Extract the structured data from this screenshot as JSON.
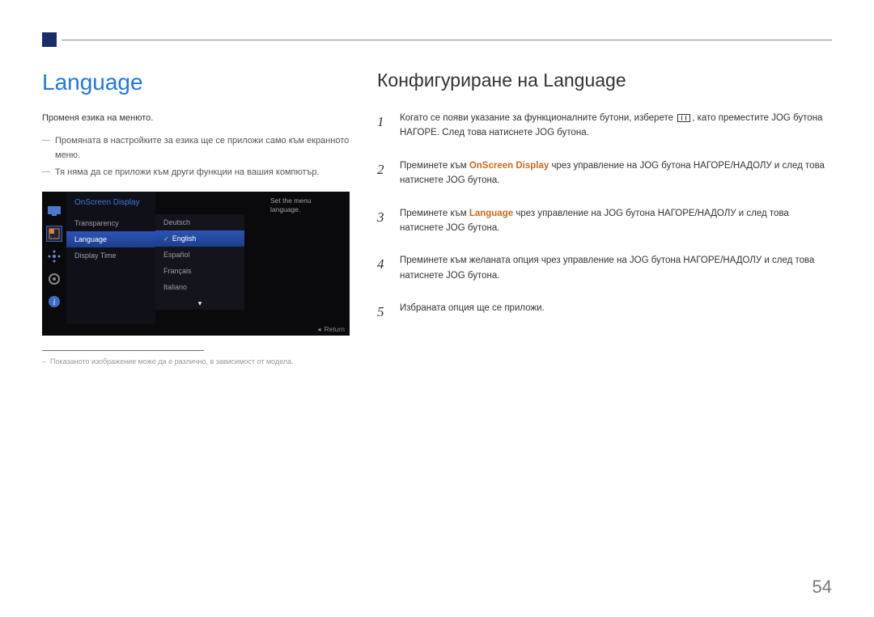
{
  "left": {
    "heading": "Language",
    "lead": "Променя езика на менюто.",
    "notes": [
      "Промяната в настройките за езика ще се приложи само към екранното меню.",
      "Тя няма да се приложи към други функции на вашия компютър."
    ],
    "footnote": "Показаното изображение може да е различно, в зависимост от модела."
  },
  "osd": {
    "title": "OnScreen Display",
    "menu": {
      "items": [
        "Transparency",
        "Language",
        "Display Time"
      ],
      "selected_index": 1
    },
    "languages": {
      "items": [
        "Deutsch",
        "English",
        "Español",
        "Français",
        "Italiano"
      ],
      "selected_index": 1
    },
    "description": "Set the menu language.",
    "return_label": "Return"
  },
  "right": {
    "heading": "Конфигуриране на Language",
    "steps": [
      {
        "num": "1",
        "pre": "Когато се появи указание за функционалните бутони, изберете ",
        "post": ", като преместите JOG бутона НАГОРЕ. След това натиснете JOG бутона."
      },
      {
        "num": "2",
        "pre": "Преминете към ",
        "kw": "OnScreen Display",
        "post": " чрез управление на JOG бутона НАГОРЕ/НАДОЛУ и след това натиснете JOG бутона."
      },
      {
        "num": "3",
        "pre": "Преминете към ",
        "kw": "Language",
        "post": " чрез управление на JOG бутона НАГОРЕ/НАДОЛУ и след това натиснете JOG бутона."
      },
      {
        "num": "4",
        "text": "Преминете към желаната опция чрез управление на JOG бутона НАГОРЕ/НАДОЛУ и след това натиснете JOG бутона."
      },
      {
        "num": "5",
        "text": "Избраната опция ще се приложи."
      }
    ]
  },
  "page_number": "54"
}
